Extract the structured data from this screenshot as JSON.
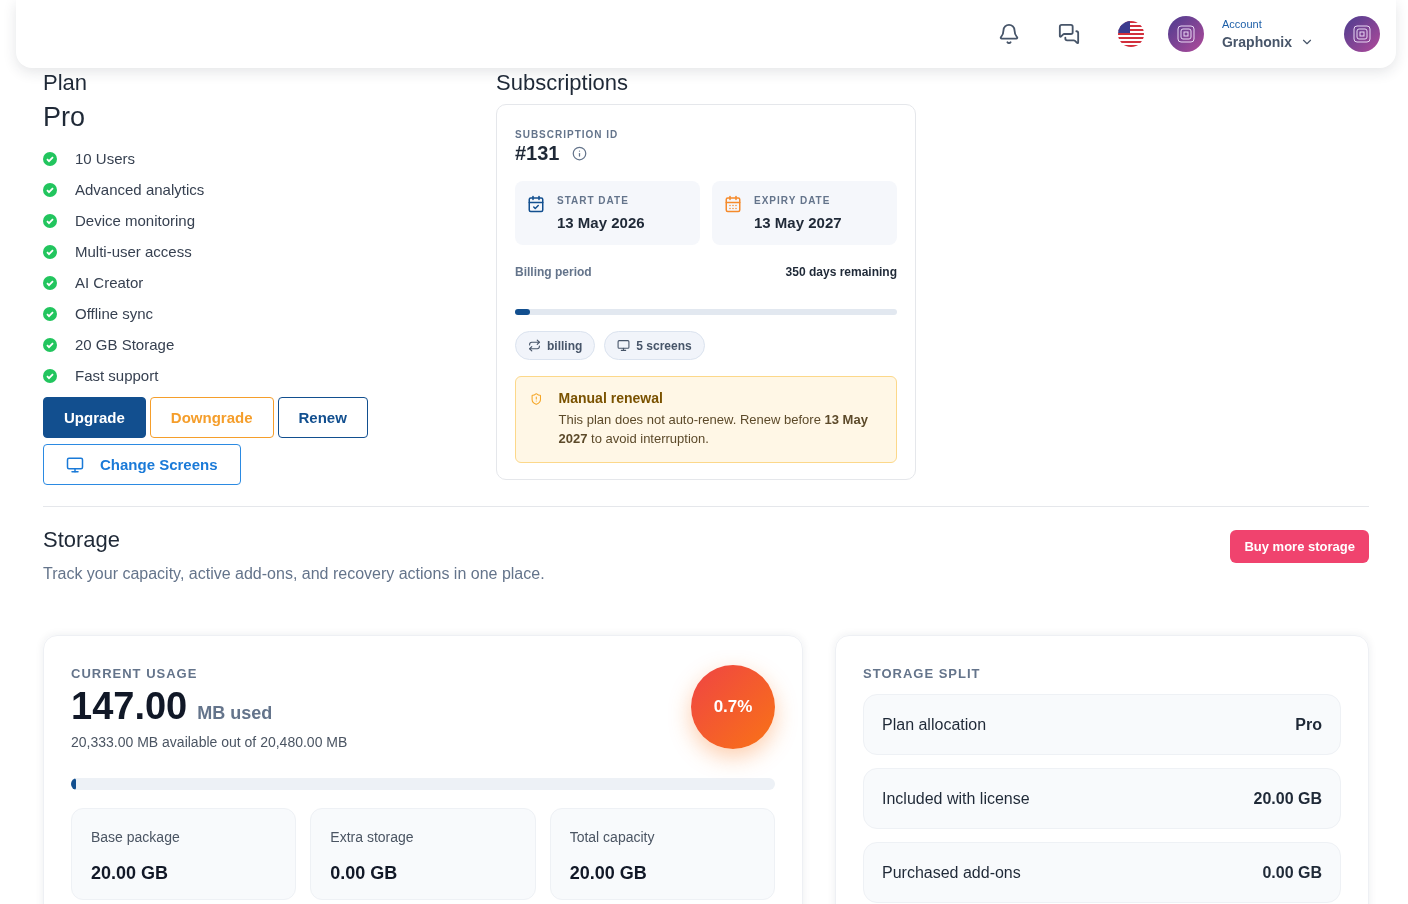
{
  "header": {
    "account_label": "Account",
    "account_name": "Graphonix"
  },
  "plan": {
    "heading": "Plan",
    "name": "Pro",
    "features": [
      "10 Users",
      "Advanced analytics",
      "Device monitoring",
      "Multi-user access",
      "AI Creator",
      "Offline sync",
      "20 GB Storage",
      "Fast support"
    ],
    "buttons": [
      {
        "label": "Upgrade",
        "kind": "primary"
      },
      {
        "label": "Downgrade",
        "kind": "warning"
      },
      {
        "label": "Renew",
        "kind": "outline"
      }
    ],
    "change_screens": "Change Screens"
  },
  "subscription": {
    "heading": "Subscriptions",
    "id_label": "SUBSCRIPTION ID",
    "id": "#131",
    "dates": [
      {
        "label": "START DATE",
        "value": "13 May 2026",
        "kind": "start"
      },
      {
        "label": "EXPIRY DATE",
        "value": "13 May 2027",
        "kind": "expiry"
      }
    ],
    "billing_label": "Billing period",
    "remaining": "350 days remaining",
    "level": 0.04,
    "chips": [
      {
        "label": "billing",
        "kind": "cycle"
      },
      {
        "label": "5 screens",
        "kind": "screen"
      }
    ],
    "notice": {
      "title": "Manual renewal",
      "text": "This plan does not auto-renew. Renew before **13 May 2027** to avoid interruption."
    }
  },
  "storage": {
    "title": "Storage",
    "subtitle": "Track your capacity, active add-ons, and recovery actions in one place.",
    "buy_button": "Buy more storage",
    "usage": {
      "label": "CURRENT USAGE",
      "amount": "147.00",
      "unit": "MB used",
      "available": "20,333.00 MB available out of 20,480.00 MB",
      "percent": "0.7%",
      "level": 0.007,
      "tiles": [
        {
          "label": "Base package",
          "value": "20.00 GB"
        },
        {
          "label": "Extra storage",
          "value": "0.00 GB"
        },
        {
          "label": "Total capacity",
          "value": "20.00 GB"
        }
      ]
    },
    "split": {
      "label": "STORAGE SPLIT",
      "rows": [
        {
          "label": "Plan allocation",
          "value": "Pro"
        },
        {
          "label": "Included with license",
          "value": "20.00 GB"
        },
        {
          "label": "Purchased add-ons",
          "value": "0.00 GB"
        }
      ]
    }
  }
}
